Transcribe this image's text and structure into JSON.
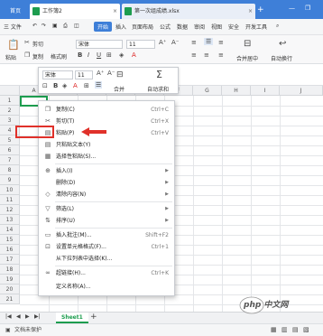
{
  "tabs": {
    "home": "首页",
    "items": [
      {
        "label": "工作簿2"
      },
      {
        "label": "第一次组成绩.xlsx"
      }
    ]
  },
  "menubar": {
    "items": [
      "三 文件",
      "开始",
      "插入",
      "页面布局",
      "公式",
      "数据",
      "审阅",
      "视图",
      "安全",
      "开发工具"
    ]
  },
  "toolbar": {
    "cut": "剪切",
    "paste": "粘贴",
    "copy": "复制",
    "format_painter": "格式刷",
    "font": "宋体",
    "font_size": "11",
    "merge_center": "合并居中",
    "auto_wrap": "自动换行"
  },
  "mini_toolbar": {
    "font": "宋体",
    "font_size": "11",
    "merge": "合并",
    "autosum": "自动求和"
  },
  "grid": {
    "columns": [
      "A",
      "B",
      "C",
      "D",
      "E",
      "F",
      "G",
      "H",
      "I",
      "J"
    ],
    "rows": [
      "1",
      "2",
      "3",
      "4",
      "5",
      "6",
      "7",
      "8",
      "9",
      "10",
      "11",
      "12",
      "13",
      "14",
      "15",
      "16",
      "17",
      "18",
      "19",
      "20",
      "21"
    ]
  },
  "context_menu": {
    "items": [
      {
        "icon": "copy-icon",
        "label": "复制(C)",
        "shortcut": "Ctrl+C"
      },
      {
        "icon": "cut-icon",
        "label": "剪切(T)",
        "shortcut": "Ctrl+X"
      },
      {
        "icon": "paste-icon",
        "label": "粘贴(P)",
        "shortcut": "Ctrl+V"
      },
      {
        "icon": "paste-text-icon",
        "label": "只粘贴文本(Y)",
        "shortcut": ""
      },
      {
        "icon": "paste-special-icon",
        "label": "选择性粘贴(S)...",
        "shortcut": ""
      },
      {
        "icon": "insert-icon",
        "label": "插入(I)",
        "shortcut": ""
      },
      {
        "icon": "",
        "label": "删除(D)",
        "shortcut": ""
      },
      {
        "icon": "clear-icon",
        "label": "清除内容(N)",
        "shortcut": ""
      },
      {
        "icon": "filter-icon",
        "label": "筛选(L)",
        "shortcut": ""
      },
      {
        "icon": "sort-icon",
        "label": "排序(U)",
        "shortcut": ""
      },
      {
        "icon": "comment-icon",
        "label": "插入批注(M)...",
        "shortcut": "Shift+F2"
      },
      {
        "icon": "format-cells-icon",
        "label": "设置单元格格式(F)...",
        "shortcut": "Ctrl+1"
      },
      {
        "icon": "",
        "label": "从下拉列表中选择(K)...",
        "shortcut": ""
      },
      {
        "icon": "hyperlink-icon",
        "label": "超链接(H)...",
        "shortcut": "Ctrl+K"
      },
      {
        "icon": "",
        "label": "定义名称(A)...",
        "shortcut": ""
      }
    ]
  },
  "sheet": {
    "name": "Sheet1"
  },
  "status": {
    "left": "文档未保护"
  },
  "watermark": {
    "text": "php 中文网"
  },
  "colors": {
    "accent": "#3e7fd8",
    "sheet_green": "#1d9d4f",
    "highlight_red": "#e0312a"
  }
}
